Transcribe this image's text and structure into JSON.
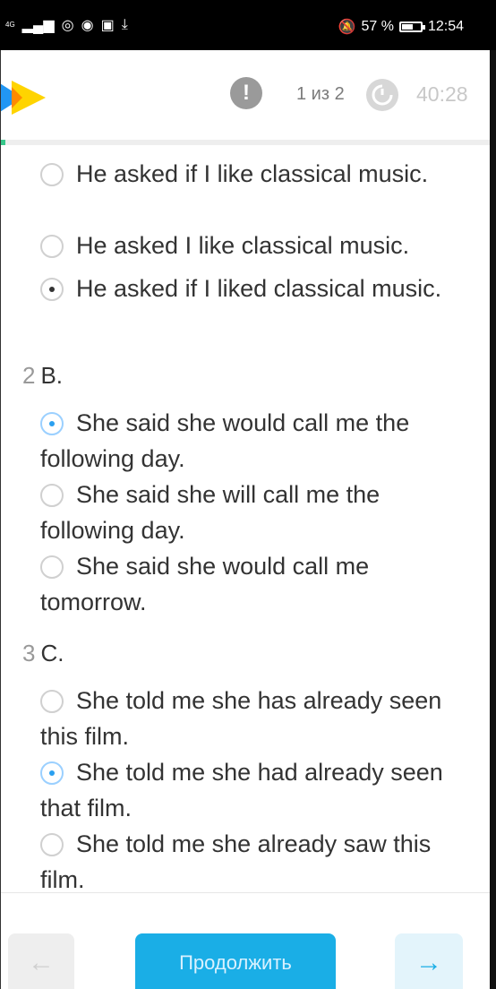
{
  "status_bar": {
    "network": "4G",
    "battery": "57 %",
    "battery_level": 0.57,
    "time": "12:54"
  },
  "header": {
    "page_counter": "1 из 2",
    "timer": "40:28"
  },
  "progress": {
    "fraction": 0.01
  },
  "options_q1": [
    {
      "text": "He asked if I like classical music.",
      "selected": false
    },
    {
      "text": "He asked I like classical music.",
      "selected": false
    },
    {
      "text": "He asked if I liked classical music.",
      "selected": true
    }
  ],
  "question2": {
    "number": "2",
    "label": "B."
  },
  "options_q2": [
    {
      "text": "She said she would call me the following day.",
      "selected": true
    },
    {
      "text": "She said she will call me the following day.",
      "selected": false
    },
    {
      "text": "She said she would call me tomorrow.",
      "selected": false
    }
  ],
  "question3": {
    "number": "3",
    "label": "C."
  },
  "options_q3": [
    {
      "text": "She told me she has already seen this film.",
      "selected": false
    },
    {
      "text": "She told me she had already seen that film.",
      "selected": true
    },
    {
      "text": "She told me she already saw this film.",
      "selected": false
    }
  ],
  "footer": {
    "back_icon": "←",
    "continue_label": "Продолжить",
    "next_icon": "→"
  },
  "colors": {
    "accent": "#1aaee6",
    "logo_blue": "#2196f3",
    "logo_yellow": "#ffd400",
    "progress": "#37c78a"
  }
}
